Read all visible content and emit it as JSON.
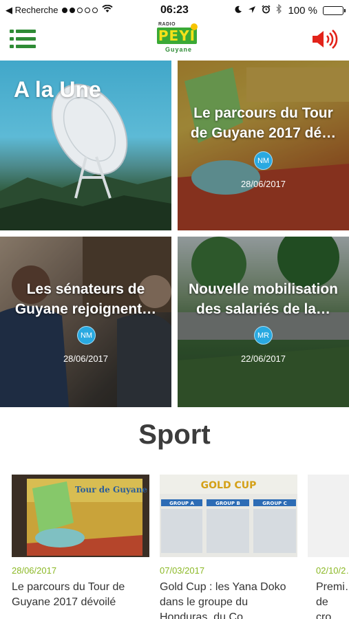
{
  "status_bar": {
    "back_label": "◀ Recherche",
    "time": "06:23",
    "battery": "100 %",
    "signal_dots_filled": 2,
    "signal_dots_total": 5
  },
  "header": {
    "logo_radio": "RADIO",
    "logo_name": "PEYI",
    "logo_region": "Guyane",
    "menu_icon": "hamburger-menu-icon",
    "sound_icon": "speaker-icon",
    "accent_color": "#2e8b35",
    "sound_color": "#e2231a"
  },
  "featured": {
    "section_label": "A la Une",
    "cards": [
      {
        "title": "Le parcours du Tour de Guyane 2017 dé…",
        "author_initials": "NM",
        "date": "28/06/2017"
      },
      {
        "title": "Les sénateurs de Guyane rejoignent…",
        "author_initials": "NM",
        "date": "28/06/2017"
      },
      {
        "title": "Nouvelle mobilisation des salariés de la…",
        "author_initials": "MR",
        "date": "22/06/2017"
      }
    ]
  },
  "sport": {
    "section_title": "Sport",
    "items": [
      {
        "date": "28/06/2017",
        "title": "Le parcours du Tour de Guyane 2017 dévoilé",
        "poster_text": "Tour de Guyane"
      },
      {
        "date": "07/03/2017",
        "title": "Gold Cup : les Yana Doko dans le groupe du Honduras, du Co…",
        "poster_text": "GOLD CUP",
        "groups": [
          "GROUP A",
          "GROUP B",
          "GROUP C"
        ]
      },
      {
        "date": "02/10/2…",
        "title": "Premi… de cro…"
      }
    ]
  }
}
